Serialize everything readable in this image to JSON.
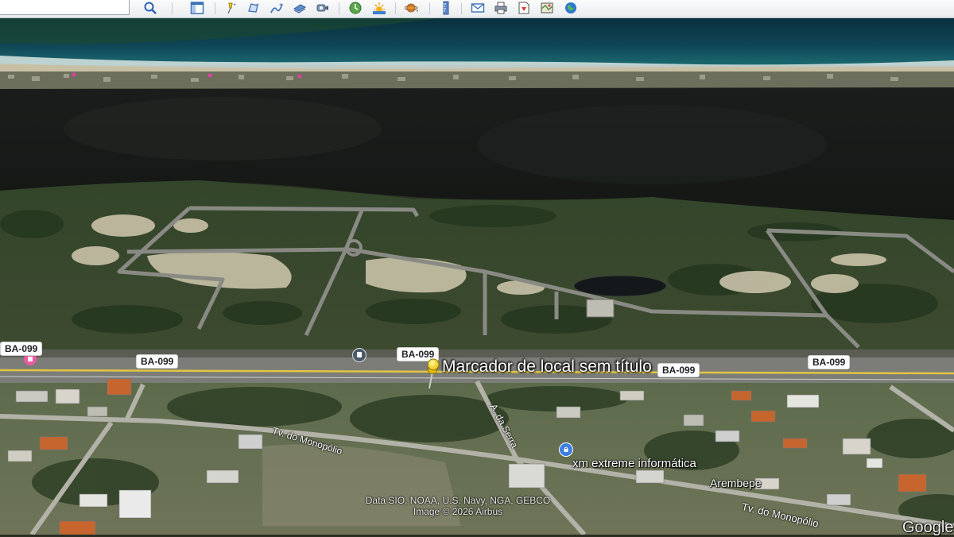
{
  "toolbar": {
    "buttons": [
      {
        "name": "search-icon"
      },
      {
        "name": "sidebar-toggle-icon"
      },
      {
        "name": "add-placemark-icon"
      },
      {
        "name": "add-polygon-icon"
      },
      {
        "name": "add-path-icon"
      },
      {
        "name": "add-image-overlay-icon"
      },
      {
        "name": "record-tour-icon"
      },
      {
        "name": "historical-imagery-icon"
      },
      {
        "name": "sunlight-icon"
      },
      {
        "name": "planets-icon"
      },
      {
        "name": "ruler-icon"
      },
      {
        "name": "email-icon"
      },
      {
        "name": "print-icon"
      },
      {
        "name": "save-image-icon"
      },
      {
        "name": "view-in-maps-icon"
      },
      {
        "name": "earth-icon"
      }
    ]
  },
  "map": {
    "road_labels": [
      "BA-099",
      "BA-099",
      "BA-099",
      "BA-099",
      "BA-099"
    ],
    "placemark_title": "Marcador de local sem título",
    "streets": {
      "street_1": "Tv. do Monopólio",
      "street_2": "A. da Serra",
      "street_3": "Tv. do Monopólio"
    },
    "poi_label": "xm extreme informática",
    "town_label": "Arembepe",
    "attribution": {
      "line1": "Data SIO, NOAA, U.S. Navy, NGA, GEBCO",
      "line2": "Image © 2026 Airbus"
    },
    "logo": "Google",
    "colors": {
      "ocean": "#0d3b4f",
      "lagoon": "#1c1c1a",
      "vegetation": "#2f4a25",
      "sand": "#c9c2a8",
      "road": "#8a8a84",
      "placemark": "#f2d51c"
    }
  }
}
